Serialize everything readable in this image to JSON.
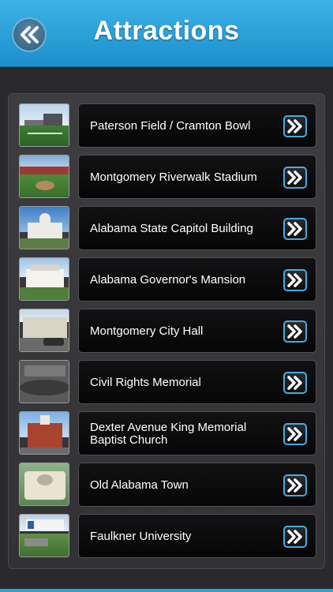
{
  "header": {
    "title": "Attractions",
    "back_icon": "double-chevron-left-icon",
    "color_top": "#3cb3e6",
    "color_bottom": "#1d8fcb"
  },
  "list": {
    "go_icon": "double-chevron-right-icon",
    "accent": "#4aa9df",
    "items": [
      {
        "label": "Paterson Field / Cramton Bowl",
        "thumb": "stadium-field-photo"
      },
      {
        "label": "Montgomery Riverwalk Stadium",
        "thumb": "baseball-stadium-photo"
      },
      {
        "label": "Alabama State Capitol Building",
        "thumb": "capitol-building-photo"
      },
      {
        "label": "Alabama Governor's Mansion",
        "thumb": "mansion-photo"
      },
      {
        "label": "Montgomery City Hall",
        "thumb": "city-hall-photo"
      },
      {
        "label": "Civil Rights Memorial",
        "thumb": "memorial-photo"
      },
      {
        "label": "Dexter Avenue King Memorial Baptist Church",
        "thumb": "church-photo"
      },
      {
        "label": "Old Alabama Town",
        "thumb": "town-sign-photo"
      },
      {
        "label": "Faulkner University",
        "thumb": "university-sign-photo"
      }
    ]
  }
}
